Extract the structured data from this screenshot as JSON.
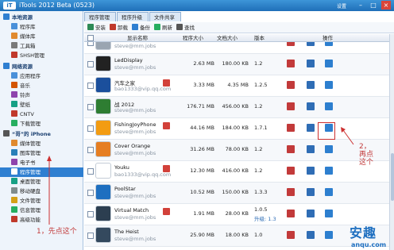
{
  "window": {
    "title": "iTools 2012 Beta (0523)",
    "settings": "设置",
    "min": "–",
    "max": "□",
    "close": "×"
  },
  "sidebar": [
    {
      "label": "本地资源",
      "section": true,
      "color": "#2f7fd1"
    },
    {
      "label": "程序库",
      "color": "#4a90d9"
    },
    {
      "label": "媒体库",
      "color": "#e08a2e"
    },
    {
      "label": "工具箱",
      "color": "#7a7a7a"
    },
    {
      "label": "SHSH管理",
      "color": "#c0392b"
    },
    {
      "label": "网络资源",
      "section": true,
      "color": "#2f7fd1"
    },
    {
      "label": "应用程序",
      "color": "#4a90d9"
    },
    {
      "label": "音乐",
      "color": "#d35400"
    },
    {
      "label": "铃声",
      "color": "#8e44ad"
    },
    {
      "label": "壁纸",
      "color": "#16a085"
    },
    {
      "label": "CNTV",
      "color": "#c0392b"
    },
    {
      "label": "下载管理",
      "color": "#27ae60"
    },
    {
      "label": "“哥”的 iPhone",
      "section": true,
      "color": "#555555"
    },
    {
      "label": "媒体管理",
      "color": "#e08a2e"
    },
    {
      "label": "图库管理",
      "color": "#2980b9"
    },
    {
      "label": "电子书",
      "color": "#8e44ad"
    },
    {
      "label": "程序管理",
      "selected": true,
      "color": "#ffffff"
    },
    {
      "label": "桌面管理",
      "color": "#16a085"
    },
    {
      "label": "移动硬盘",
      "color": "#7f8c8d"
    },
    {
      "label": "文件管理",
      "color": "#d4a017"
    },
    {
      "label": "信息管理",
      "color": "#27ae60"
    },
    {
      "label": "高级功能",
      "color": "#c0392b"
    }
  ],
  "tabs": [
    {
      "label": "程序管理",
      "active": true
    },
    {
      "label": "程序升级",
      "active": false
    },
    {
      "label": "文件共享",
      "active": false
    }
  ],
  "toolbar": [
    {
      "label": "安装",
      "color": "#2e8b57"
    },
    {
      "label": "卸载",
      "color": "#c0392b"
    },
    {
      "label": "备份",
      "color": "#2f7fd1"
    },
    {
      "label": "刷新",
      "color": "#27ae60"
    },
    {
      "label": "查找",
      "color": "#555555"
    }
  ],
  "columns": {
    "name": "显示名称",
    "prog_size": "程序大小",
    "doc_size": "文档大小",
    "version": "版本",
    "action": "操作"
  },
  "apps": [
    {
      "name": "",
      "account": "steve@mm.jobs",
      "prog": "",
      "doc": "",
      "ver": "",
      "icon_color": "#9aa5b1"
    },
    {
      "name": "LedDisplay",
      "account": "steve@mm.jobs",
      "prog": "2.63 MB",
      "doc": "180.00 KB",
      "ver": "1.2",
      "icon_color": "#222222"
    },
    {
      "name": "汽车之家",
      "account": "bao1333@vip.qq.com",
      "prog": "3.33 MB",
      "doc": "4.35 MB",
      "ver": "1.2.5",
      "icon_color": "#1b4f9c",
      "badge": true
    },
    {
      "name": "战 2012",
      "account": "steve@mm.jobs",
      "prog": "176.71 MB",
      "doc": "456.00 KB",
      "ver": "1.2",
      "icon_color": "#2e7d32"
    },
    {
      "name": "FishingJoyPhone",
      "account": "steve@mm.jobs",
      "prog": "44.16 MB",
      "doc": "184.00 KB",
      "ver": "1.7.1",
      "icon_color": "#f39c12",
      "badge": true
    },
    {
      "name": "Cover Orange",
      "account": "steve@mm.jobs",
      "prog": "31.26 MB",
      "doc": "78.00 KB",
      "ver": "1.2",
      "icon_color": "#e67e22"
    },
    {
      "name": "Youku",
      "account": "bao1333@vip.qq.com",
      "prog": "12.30 MB",
      "doc": "416.00 KB",
      "ver": "1.2",
      "icon_color": "#ffffff",
      "badge": true
    },
    {
      "name": "PoolStar",
      "account": "steve@mm.jobs",
      "prog": "10.52 MB",
      "doc": "150.00 KB",
      "ver": "1.3.3",
      "icon_color": "#1e6fc0"
    },
    {
      "name": "Virtual Match",
      "account": "steve@mm.jobs",
      "prog": "1.91 MB",
      "doc": "28.00 KB",
      "ver": "1.0.5",
      "icon_color": "#2c3e50",
      "badge": true,
      "update": "升级: 1.3"
    },
    {
      "name": "The Heist",
      "account": "steve@mm.jobs",
      "prog": "25.90 MB",
      "doc": "18.00 KB",
      "ver": "1.0",
      "icon_color": "#34495e"
    }
  ],
  "annotations": {
    "step1": "1，先点这个",
    "step2": "2，再点这个"
  },
  "watermark": {
    "big": "安趣",
    "small": "anqu.com"
  }
}
